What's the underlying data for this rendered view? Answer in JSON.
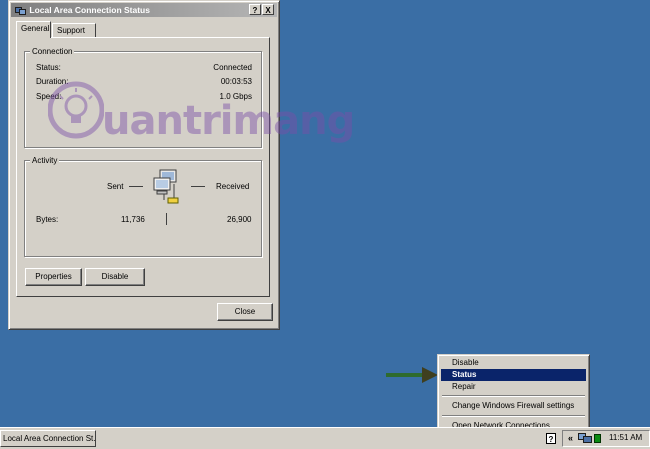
{
  "dialog": {
    "title": "Local Area Connection Status",
    "help_btn": "?",
    "close_btn": "X",
    "tabs": [
      "General",
      "Support"
    ],
    "connection": {
      "group_label": "Connection",
      "rows": [
        {
          "label": "Status:",
          "value": "Connected"
        },
        {
          "label": "Duration:",
          "value": "00:03:53"
        },
        {
          "label": "Speed:",
          "value": "1.0 Gbps"
        }
      ]
    },
    "activity": {
      "group_label": "Activity",
      "sent_label": "Sent",
      "received_label": "Received",
      "bytes_label": "Bytes:",
      "bytes_sent": "11,736",
      "bytes_received": "26,900"
    },
    "buttons": {
      "properties": "Properties",
      "disable": "Disable",
      "close": "Close"
    }
  },
  "watermark": {
    "text": "uantrimang"
  },
  "context_menu": {
    "items": [
      "Disable",
      "Status",
      "Repair",
      "Change Windows Firewall settings",
      "Open Network Connections"
    ],
    "highlighted": "Status"
  },
  "taskbar": {
    "task_button": "Local Area Connection St...",
    "help_icon": "?",
    "tray_chevron": "«",
    "clock": "11:51 AM"
  },
  "colors": {
    "desktop": "#3a6ea5",
    "highlight": "#0a246a",
    "arrow": "#2e6b2e",
    "watermark": "#7b4ea8"
  }
}
